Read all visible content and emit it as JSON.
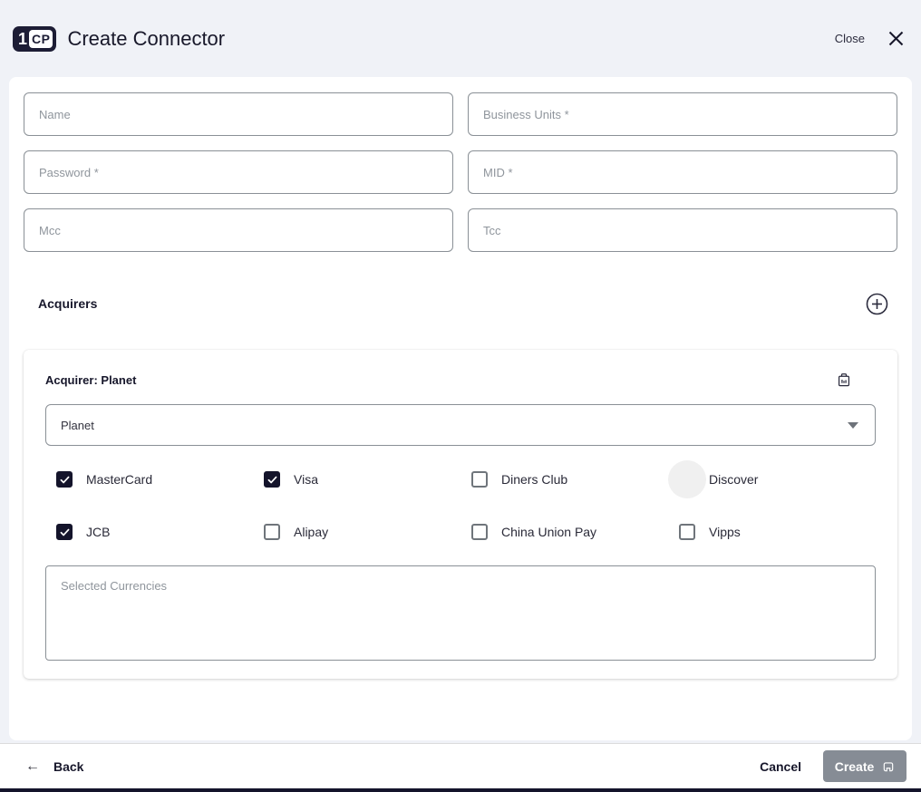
{
  "header": {
    "logo_part_one": "1",
    "logo_part_cp": "CP",
    "title": "Create Connector",
    "close_label": "Close"
  },
  "form": {
    "fields": [
      {
        "placeholder": "Name"
      },
      {
        "placeholder": "Business Units *"
      },
      {
        "placeholder": "Password *"
      },
      {
        "placeholder": "MID *"
      },
      {
        "placeholder": "Mcc"
      },
      {
        "placeholder": "Tcc"
      }
    ]
  },
  "acquirers": {
    "section_title": "Acquirers",
    "card": {
      "title": "Acquirer: Planet",
      "select_value": "Planet",
      "payment_methods": [
        {
          "label": "MasterCard",
          "checked": true
        },
        {
          "label": "Visa",
          "checked": true
        },
        {
          "label": "Diners Club",
          "checked": false
        },
        {
          "label": "Discover",
          "checked": false,
          "focused": true
        },
        {
          "label": "JCB",
          "checked": true
        },
        {
          "label": "Alipay",
          "checked": false
        },
        {
          "label": "China Union Pay",
          "checked": false
        },
        {
          "label": "Vipps",
          "checked": false
        }
      ],
      "currencies_placeholder": "Selected Currencies"
    }
  },
  "footer": {
    "back_label": "Back",
    "cancel_label": "Cancel",
    "create_label": "Create"
  },
  "colors": {
    "background": "#f0f2f7",
    "accent_dark": "#14142b",
    "input_border": "#8a9096",
    "create_button_bg": "#868c95"
  }
}
